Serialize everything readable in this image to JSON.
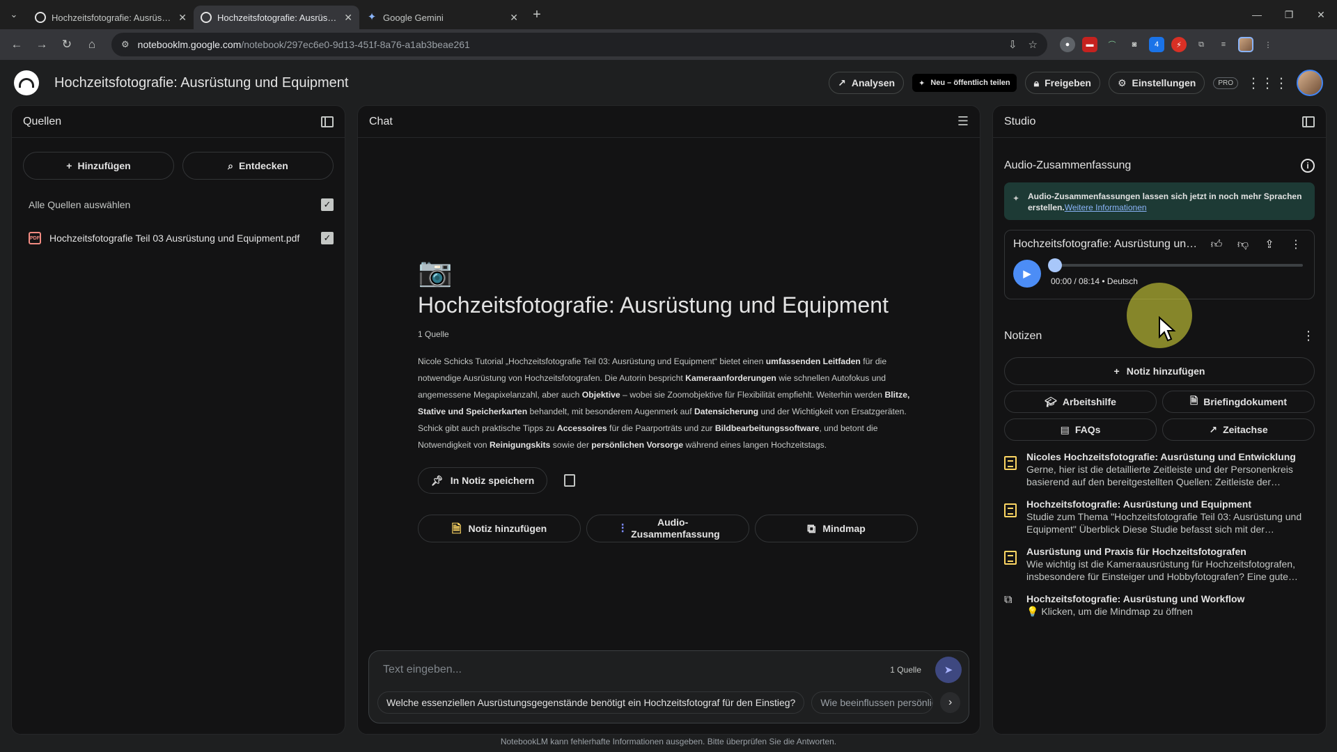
{
  "browser": {
    "tabs": [
      {
        "title": "Hochzeitsfotografie: Ausrüstun"
      },
      {
        "title": "Hochzeitsfotografie: Ausrüstun"
      },
      {
        "title": "Google Gemini"
      }
    ],
    "url_host": "notebooklm.google.com",
    "url_path": "/notebook/297ec6e0-9d13-451f-8a76-a1ab3beae261"
  },
  "header": {
    "title": "Hochzeitsfotografie: Ausrüstung und Equipment",
    "analysen": "Analysen",
    "share_new": "Neu – öffentlich teilen",
    "freigeben": "Freigeben",
    "einstellungen": "Einstellungen",
    "pro": "PRO"
  },
  "sources": {
    "title": "Quellen",
    "add": "Hinzufügen",
    "discover": "Entdecken",
    "select_all": "Alle Quellen auswählen",
    "items": [
      {
        "name": "Hochzeitsfotografie Teil 03 Ausrüstung und Equipment.pdf",
        "type_label": "PDF"
      }
    ]
  },
  "chat": {
    "title": "Chat",
    "notebook_title": "Hochzeitsfotografie: Ausrüstung und Equipment",
    "source_count": "1 Quelle",
    "summary_parts": [
      [
        "Nicole Schicks Tutorial „Hochzeitsfotografie Teil 03: Ausrüstung und Equipment“ bietet einen ",
        false
      ],
      [
        "umfassenden Leitfaden",
        true
      ],
      [
        " für die notwendige Ausrüstung von Hochzeitsfotografen. Die Autorin bespricht ",
        false
      ],
      [
        "Kameraanforderungen",
        true
      ],
      [
        " wie schnellen Autofokus und angemessene Megapixelanzahl, aber auch ",
        false
      ],
      [
        "Objektive",
        true
      ],
      [
        " – wobei sie Zoomobjektive für Flexibilität empfiehlt. Weiterhin werden ",
        false
      ],
      [
        "Blitze, Stative und Speicherkarten",
        true
      ],
      [
        " behandelt, mit besonderem Augenmerk auf ",
        false
      ],
      [
        "Datensicherung",
        true
      ],
      [
        " und der Wichtigkeit von Ersatzgeräten. Schick gibt auch praktische Tipps zu ",
        false
      ],
      [
        "Accessoires",
        true
      ],
      [
        " für die Paarporträts und zur ",
        false
      ],
      [
        "Bildbearbeitungssoftware",
        true
      ],
      [
        ", und betont die Notwendigkeit von ",
        false
      ],
      [
        "Reinigungskits",
        true
      ],
      [
        " sowie der ",
        false
      ],
      [
        "persönlichen Vorsorge",
        true
      ],
      [
        " während eines langen Hochzeitstags.",
        false
      ]
    ],
    "save_note": "In Notiz speichern",
    "quick_actions": [
      {
        "label": "Notiz hinzufügen",
        "icon": "note-icon"
      },
      {
        "label": "Audio-Zusammenfassung",
        "icon": "audio-icon"
      },
      {
        "label": "Mindmap",
        "icon": "mindmap-icon"
      }
    ],
    "input_placeholder": "Text eingeben...",
    "input_source_count": "1 Quelle",
    "suggestions": [
      "Welche essenziellen Ausrüstungsgegenstände benötigt ein Hochzeitsfotograf für den Einstieg?",
      "Wie beeinflussen persönliche"
    ]
  },
  "studio": {
    "title": "Studio",
    "audio_section": "Audio-Zusammenfassung",
    "banner_text": "Audio-Zusammenfassungen lassen sich jetzt in noch mehr Sprachen erstellen.",
    "banner_link": "Weitere Informationen",
    "player_title": "Hochzeitsfotografie: Ausrüstung und Equipment",
    "player_time": "00:00 / 08:14 • Deutsch",
    "player_progress": 0,
    "notes_title": "Notizen",
    "add_note": "Notiz hinzufügen",
    "tools": [
      {
        "label": "Arbeitshilfe",
        "icon": "study-guide-icon"
      },
      {
        "label": "Briefingdokument",
        "icon": "document-icon"
      },
      {
        "label": "FAQs",
        "icon": "faq-icon"
      },
      {
        "label": "Zeitachse",
        "icon": "timeline-icon"
      }
    ],
    "notes": [
      {
        "title": "Nicoles Hochzeitsfotografie: Ausrüstung und Entwicklung",
        "desc": "Gerne, hier ist die detaillierte Zeitleiste und der Personenkreis basierend auf den bereitgestellten Quellen: Zeitleiste der…",
        "kind": "note"
      },
      {
        "title": "Hochzeitsfotografie: Ausrüstung und Equipment",
        "desc": "Studie zum Thema \"Hochzeitsfotografie Teil 03: Ausrüstung und Equipment\" Überblick Diese Studie befasst sich mit der…",
        "kind": "note"
      },
      {
        "title": "Ausrüstung und Praxis für Hochzeitsfotografen",
        "desc": "Wie wichtig ist die Kameraausrüstung für Hochzeitsfotografen, insbesondere für Einsteiger und Hobbyfotografen? Eine gute…",
        "kind": "note"
      },
      {
        "title": "Hochzeitsfotografie: Ausrüstung und Workflow",
        "desc": "💡 Klicken, um die Mindmap zu öffnen",
        "kind": "mindmap"
      }
    ]
  },
  "footer": "NotebookLM kann fehlerhafte Informationen ausgeben. Bitte überprüfen Sie die Antworten."
}
